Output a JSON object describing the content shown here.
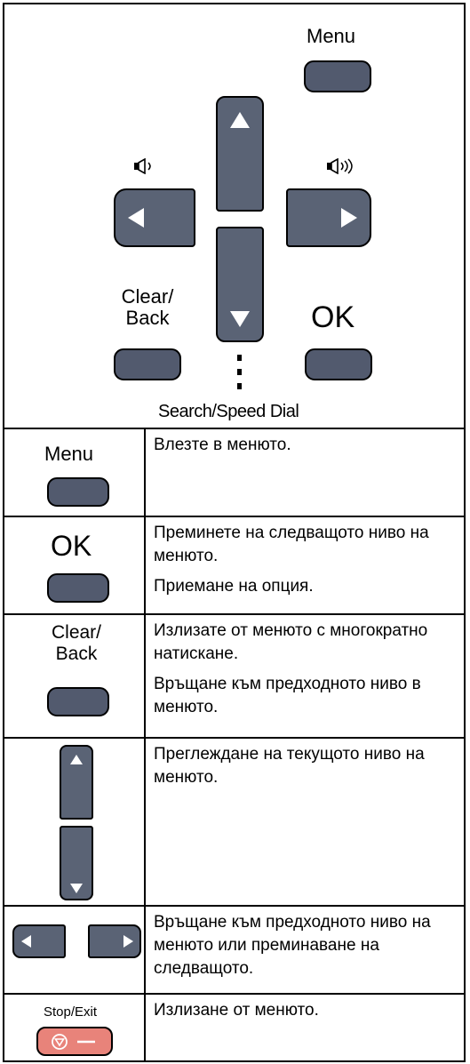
{
  "panel": {
    "menu_label": "Menu",
    "clear_label_1": "Clear/",
    "clear_label_2": "Back",
    "ok_label": "OK",
    "search_label": "Search/Speed Dial",
    "volume_low_icon": "speaker-low-icon",
    "volume_high_icon": "speaker-high-icon"
  },
  "rows": [
    {
      "key_label": "Menu",
      "lines": [
        "Влезте в менюто."
      ]
    },
    {
      "key_label": "OK",
      "lines": [
        "Преминете на следващото ниво на менюто.",
        "Приемане на опция."
      ]
    },
    {
      "key_label_1": "Clear/",
      "key_label_2": "Back",
      "lines": [
        "Излизате от менюто с многократно натискане.",
        "Връщане към предходното ниво в менюто."
      ]
    },
    {
      "lines": [
        "Преглеждане на текущото ниво на менюто."
      ]
    },
    {
      "lines": [
        "Връщане към предходното ниво на менюто или преминаване на следващото."
      ]
    },
    {
      "key_label": "Stop/Exit",
      "lines": [
        "Излизане от менюто."
      ]
    }
  ],
  "colors": {
    "key_fill": "#525a6e",
    "stop_fill": "#e8837a"
  }
}
